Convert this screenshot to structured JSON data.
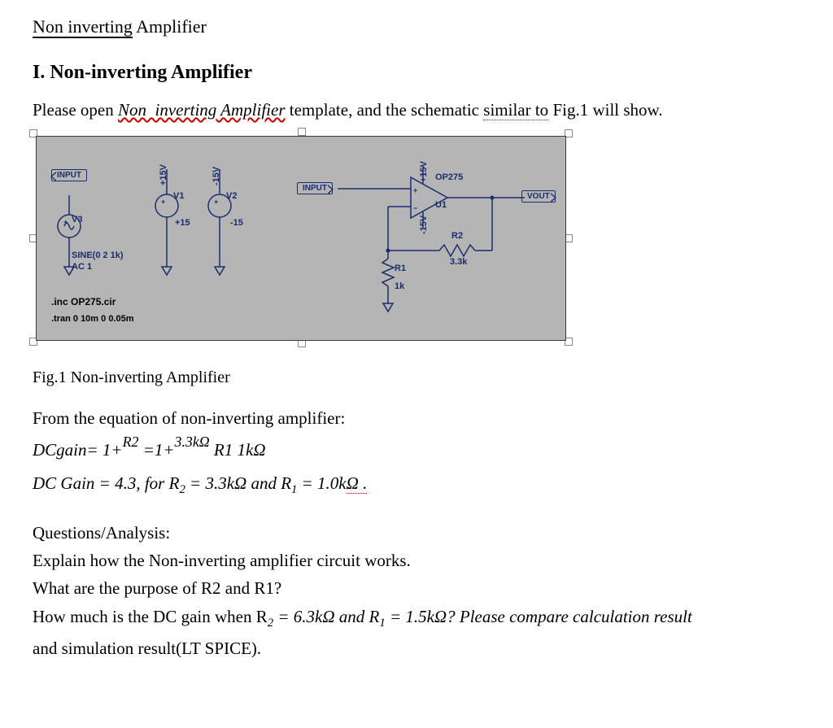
{
  "title_part1": "Non inverting",
  "title_part2": " Amplifier",
  "section_heading": "I. Non-inverting Amplifier",
  "para1_a": "Please open ",
  "para1_link": "Non  inverting",
  "para1_link2": " Amplifier",
  "para1_b": " template, and the schematic ",
  "para1_similar": "similar to",
  "para1_c": " Fig.1 will show.",
  "schematic": {
    "net_input_left": "INPUT",
    "net_input_right": "INPUT",
    "net_vout": "VOUT",
    "v1": "V1",
    "v2": "V2",
    "v3": "V3",
    "rail_plus15": "+15V",
    "rail_minus15": "-15V",
    "val_plus15": "+15",
    "val_minus15": "-15",
    "u1": "U1",
    "op275": "OP275",
    "r1": "R1",
    "r1_val": "1k",
    "r2": "R2",
    "r2_val": "3.3k",
    "sine": "SINE(0 2 1k)",
    "ac1": "AC 1",
    "spice_inc": ".inc OP275.cir",
    "spice_tran": ".tran 0 10m 0 0.05m"
  },
  "fig_caption": "Fig.1 Non-inverting Amplifier",
  "para2": "From the equation of non-inverting amplifier:",
  "eq1_a": "DCgain= 1+",
  "eq1_R2": "R2",
  "eq1_b": " =1+",
  "eq1_val": "3.3kΩ",
  "eq1_R1": " R1 1kΩ",
  "eq2_a": "DC Gain = 4.3, for R",
  "eq2_sub2": "2",
  "eq2_b": " = 3.3kΩ and R",
  "eq2_sub1": "1",
  "eq2_c": " = 1.0k",
  "eq2_omega": "Ω .",
  "qa_head": "Questions/Analysis:",
  "qa1": "Explain how the Non-inverting amplifier circuit works.",
  "qa2": "What are the purpose of R2 and R1?",
  "qa3_a": "How much is the DC gain when R",
  "qa3_sub2": "2",
  "qa3_b": " = 6.3kΩ and R",
  "qa3_sub1": "1",
  "qa3_c": " = 1.5kΩ? Please compare calculation result",
  "qa4": "and simulation result(LT SPICE)."
}
